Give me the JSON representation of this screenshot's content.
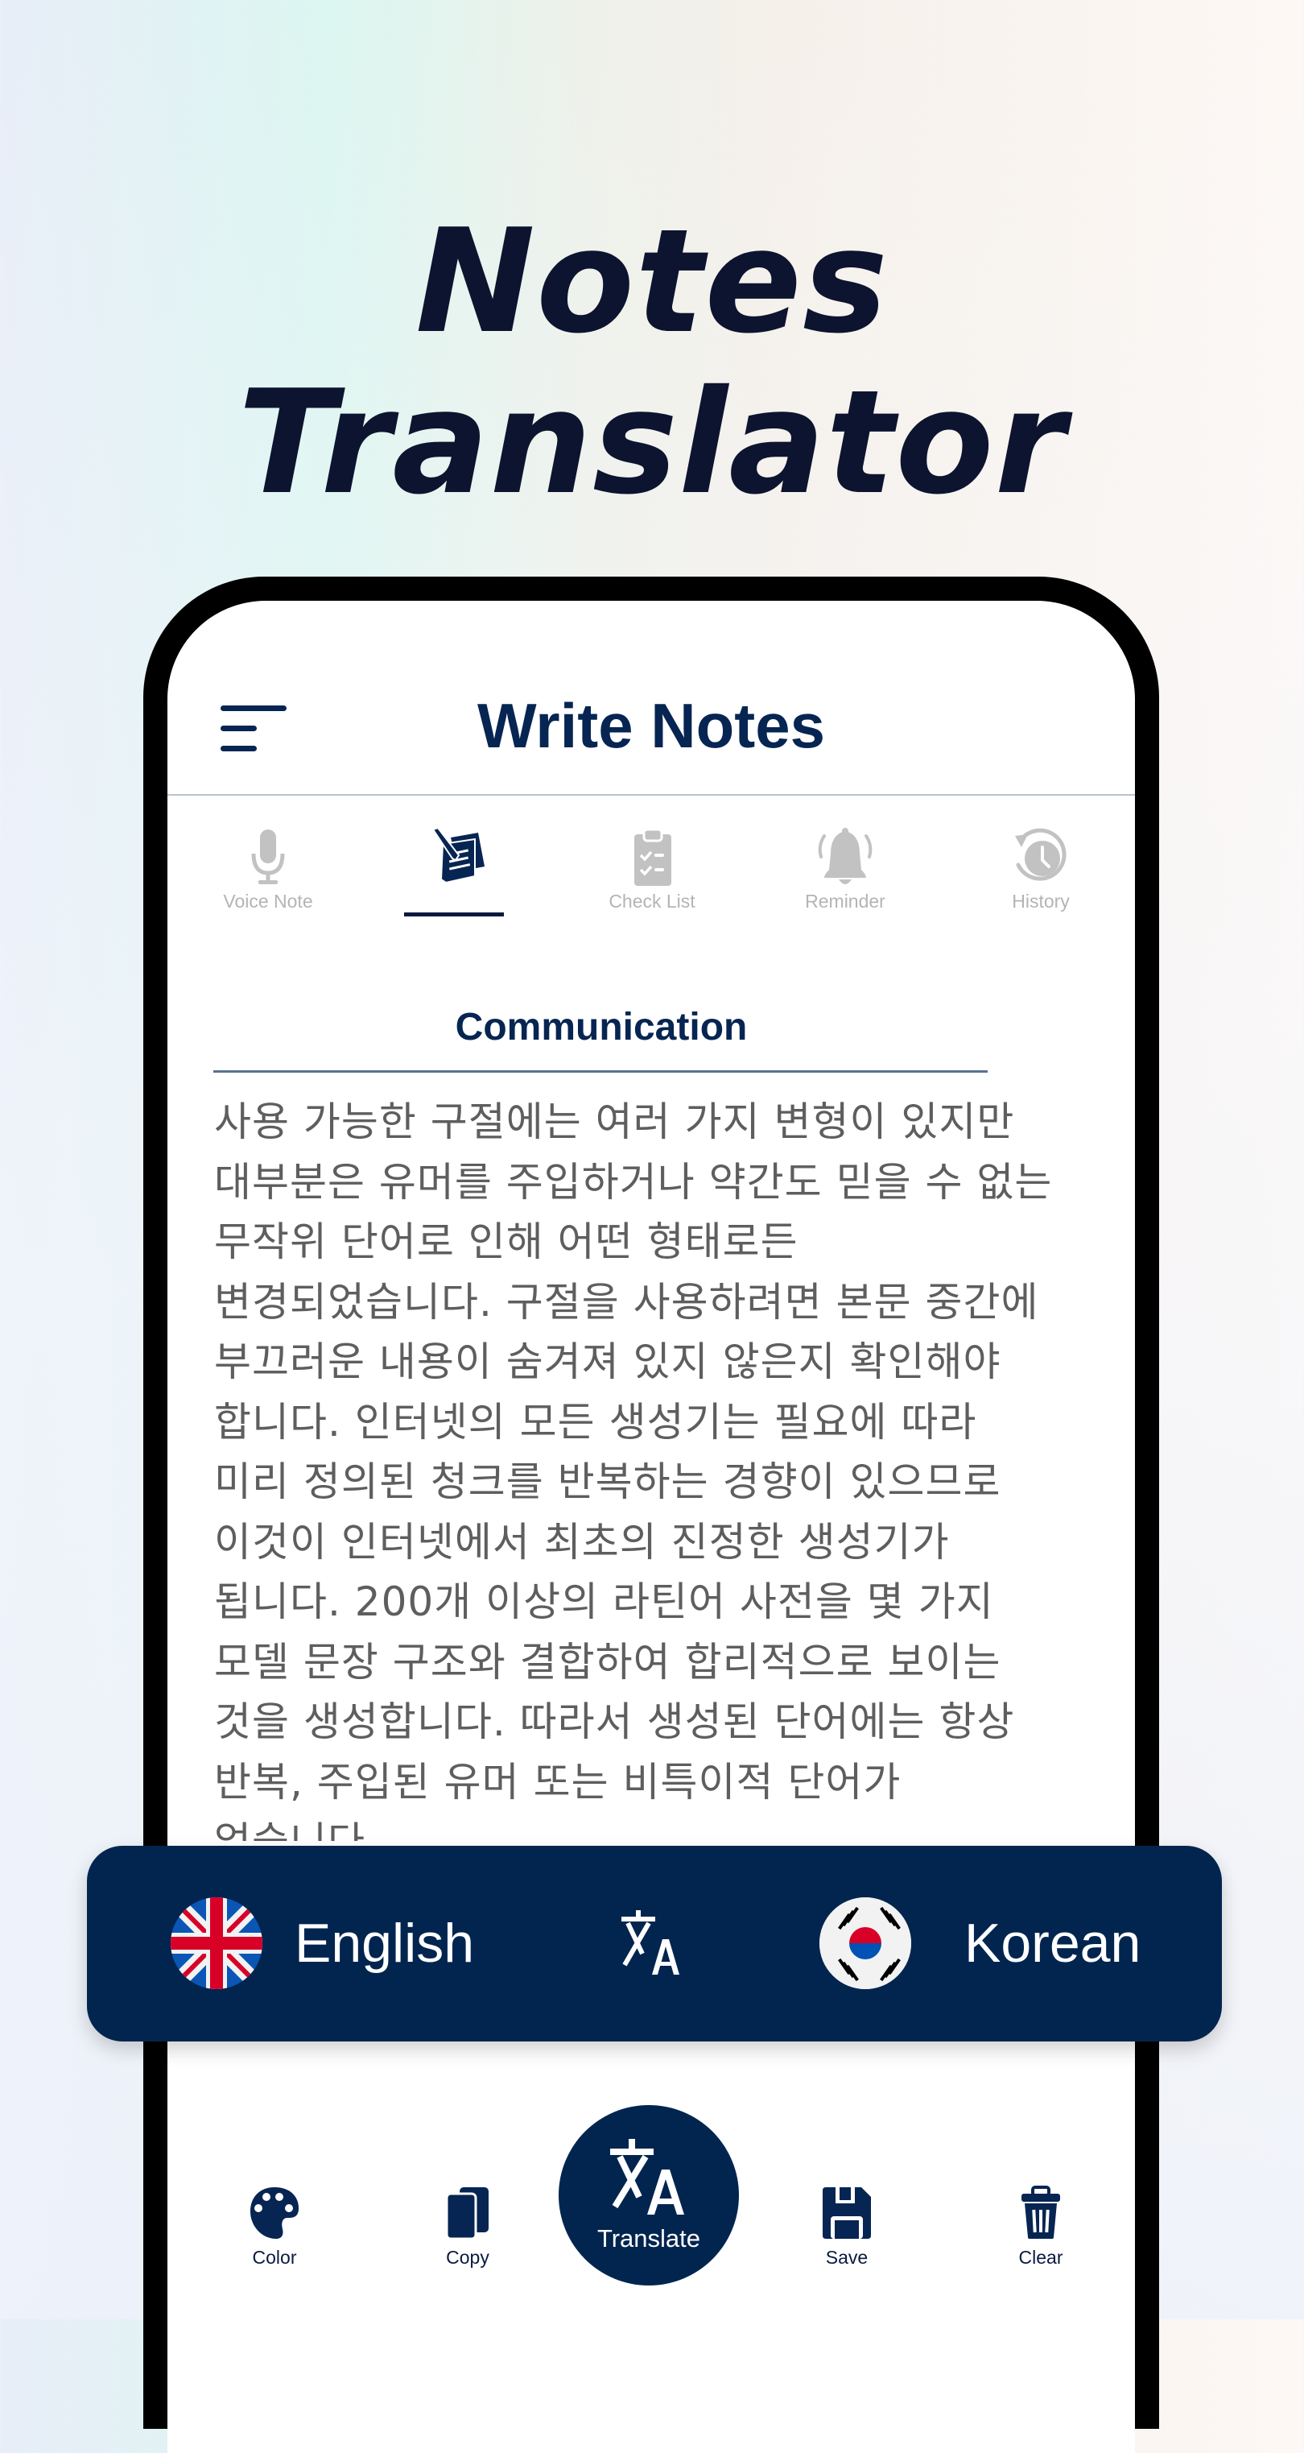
{
  "hero": {
    "title": "Notes Translator"
  },
  "app": {
    "title": "Write Notes",
    "menu_icon": "hamburger-menu-icon"
  },
  "tabs": [
    {
      "label": "Voice Note",
      "icon": "microphone-icon",
      "active": false
    },
    {
      "label": "",
      "icon": "write-note-icon",
      "active": true
    },
    {
      "label": "Check List",
      "icon": "clipboard-checklist-icon",
      "active": false
    },
    {
      "label": "Reminder",
      "icon": "bell-icon",
      "active": false
    },
    {
      "label": "History",
      "icon": "history-clock-icon",
      "active": false
    }
  ],
  "note": {
    "title": "Communication",
    "body_lines": [
      "사용 가능한 구절에는 여러 가지 변형이 있지만",
      "대부분은 유머를 주입하거나 약간도 믿을 수 없는",
      "무작위 단어로 인해 어떤 형태로든",
      "변경되었습니다. 구절을 사용하려면 본문 중간에",
      "부끄러운 내용이 숨겨져 있지 않은지 확인해야",
      "합니다. 인터넷의 모든 생성기는 필요에 따라",
      "미리 정의된 청크를 반복하는 경향이 있으므로",
      "이것이 인터넷에서 최초의 진정한 생성기가",
      "됩니다. 200개 이상의 라틴어 사전을 몇 가지",
      "모델 문장 구조와 결합하여 합리적으로 보이는",
      "것을 생성합니다. 따라서 생성된 단어에는 항상",
      "반복, 주입된 유머 또는 비특이적 단어가",
      "없습니다."
    ]
  },
  "language_bar": {
    "source_language": "English",
    "source_flag": "uk-flag-icon",
    "target_language": "Korean",
    "target_flag": "south-korea-flag-icon",
    "swap_icon": "translate-icon"
  },
  "toolbar": {
    "color_label": "Color",
    "copy_label": "Copy",
    "translate_label": "Translate",
    "save_label": "Save",
    "clear_label": "Clear"
  },
  "colors": {
    "primary": "#02254f",
    "title_text": "#0d1430",
    "inactive_tab": "#b4b4b4",
    "body_text": "#5e5e5e"
  }
}
